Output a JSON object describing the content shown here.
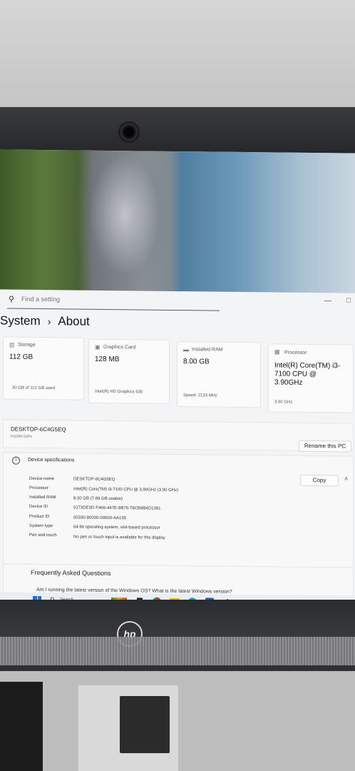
{
  "search": {
    "placeholder": "Find a setting"
  },
  "breadcrumb": {
    "parent": "System",
    "separator": "›",
    "current": "About"
  },
  "cards": [
    {
      "title": "Storage",
      "value": "112 GB",
      "sub": "30 GB of 112 GB used",
      "icon": "storage-icon"
    },
    {
      "title": "Graphics Card",
      "value": "128 MB",
      "sub": "Intel(R) HD Graphics 630",
      "icon": "graphics-card-icon"
    },
    {
      "title": "Installed RAM",
      "value": "8.00 GB",
      "sub": "Speed: 2133 MHz",
      "icon": "ram-icon"
    },
    {
      "title": "Processor",
      "value": "Intel(R) Core(TM) i3-7100 CPU @ 3.90GHz",
      "sub": "3.90 GHz",
      "icon": "processor-icon"
    }
  ],
  "device": {
    "name": "DESKTOP-6C4G5EQ",
    "model": "H110M-S2PV",
    "rename_label": "Rename this PC"
  },
  "specs": {
    "title": "Device specifications",
    "copy_label": "Copy",
    "rows": [
      {
        "label": "Device name",
        "value": "DESKTOP-6C4G5EQ"
      },
      {
        "label": "Processor",
        "value": "Intel(R) Core(TM) i3-7100 CPU @ 3.90GHz (3.90 GHz)"
      },
      {
        "label": "Installed RAM",
        "value": "8.00 GB (7.89 GB usable)"
      },
      {
        "label": "Device ID",
        "value": "0173DE3D-F466-447E-8B76-78CB9B4D1381"
      },
      {
        "label": "Product ID",
        "value": "00330-80000-00000-AA135"
      },
      {
        "label": "System type",
        "value": "64-bit operating system, x64-based processor"
      },
      {
        "label": "Pen and touch",
        "value": "No pen or touch input is available for this display"
      }
    ]
  },
  "faq": {
    "title": "Frequently Asked Questions",
    "question": "Am I running the latest version of the Windows OS? What is the latest Windows version?"
  },
  "taskbar": {
    "search_label": "Search"
  },
  "brand": {
    "logo": "hp"
  },
  "colors": {
    "accent": "#0067c0",
    "background": "#f3f4f6",
    "card": "#fbfbfb"
  }
}
